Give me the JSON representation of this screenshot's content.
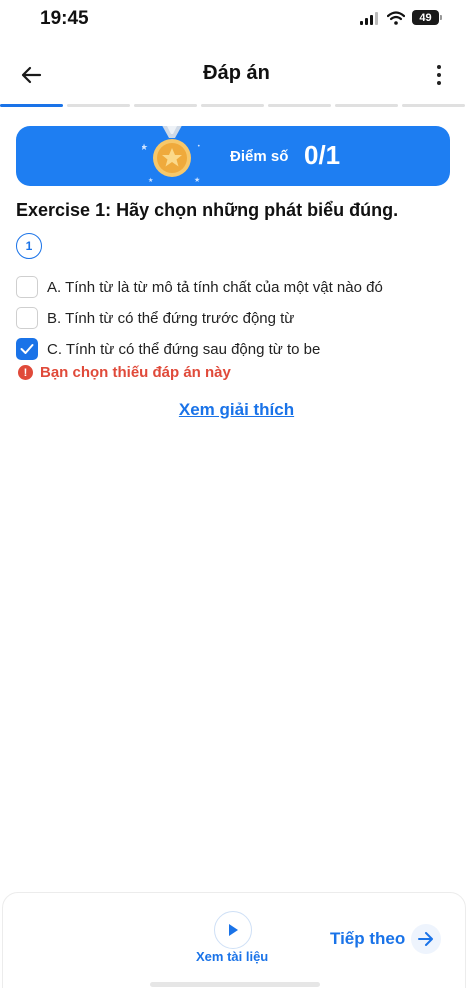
{
  "status_bar": {
    "time": "19:45",
    "battery": "49"
  },
  "header": {
    "title": "Đáp án",
    "back_icon": "arrow-left-icon",
    "menu_icon": "more-vertical-icon"
  },
  "progress": {
    "total_segments": 7,
    "current_segment": 1
  },
  "score": {
    "label": "Điểm số",
    "value": "0/1",
    "icon": "medal-icon"
  },
  "question": {
    "title": "Exercise 1: Hãy chọn những phát biểu đúng.",
    "number": "1",
    "options": [
      {
        "label": "A. Tính từ là từ mô tả tính chất của một vật nào đó",
        "checked": false
      },
      {
        "label": "B. Tính từ có thể đứng trước động từ",
        "checked": false
      },
      {
        "label": "C. Tính từ có thể đứng sau động từ to be",
        "checked": true
      }
    ],
    "feedback": "Bạn chọn thiếu đáp án này",
    "explain_link": "Xem giải thích"
  },
  "bottom": {
    "docs_label": "Xem tài liệu",
    "next_label": "Tiếp theo"
  },
  "colors": {
    "accent": "#1a73e8",
    "banner": "#1e7ef2",
    "error": "#e04a3a"
  }
}
